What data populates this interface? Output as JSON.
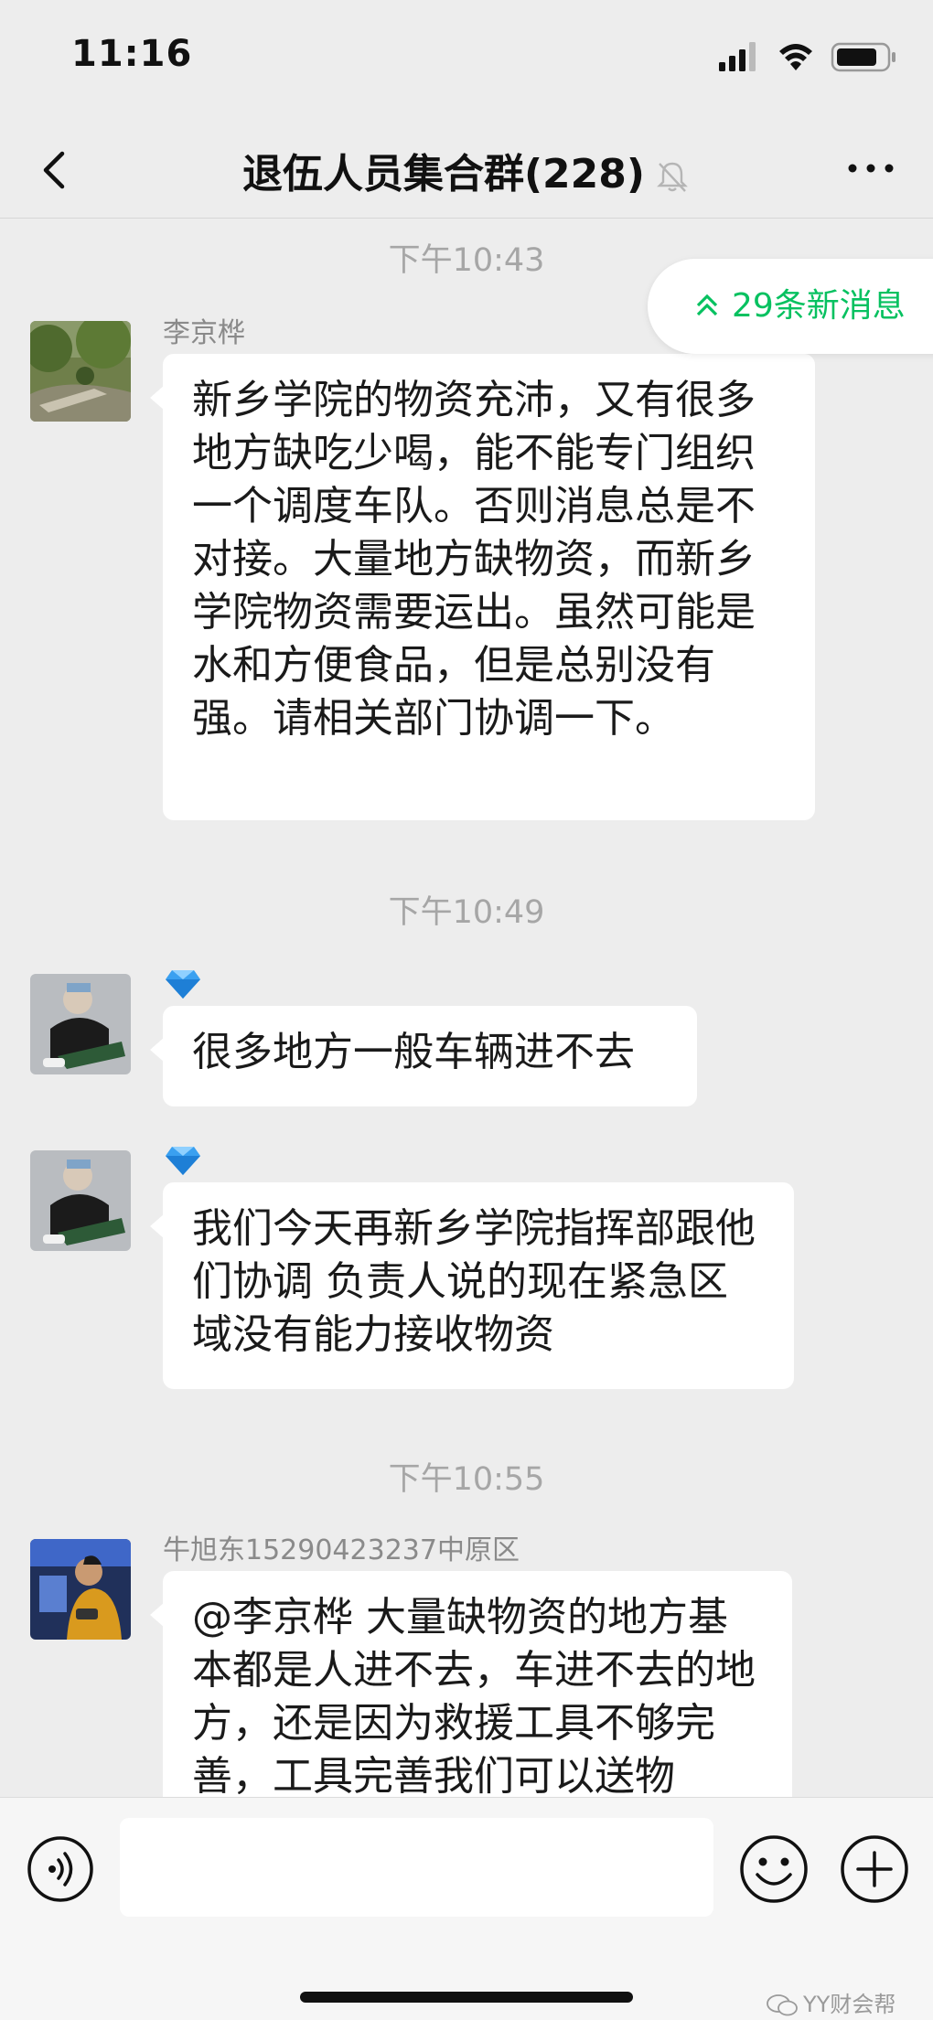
{
  "status_bar": {
    "time": "11:16"
  },
  "header": {
    "title": "退伍人员集合群(228)"
  },
  "new_messages_pill": {
    "label": "29条新消息",
    "color": "#07c160"
  },
  "timestamps": [
    "下午10:43",
    "下午10:49",
    "下午10:55"
  ],
  "messages": [
    {
      "sender": "李京桦",
      "text": "新乡学院的物资充沛，又有很多地方缺吃少喝，能不能专门组织一个调度车队。否则消息总是不对接。大量地方缺物资，而新乡学院物资需要运出。虽然可能是水和方便食品，但是总别没有强。请相关部门协调一下。"
    },
    {
      "sender_badge": "diamond-icon",
      "text": "很多地方一般车辆进不去"
    },
    {
      "sender_badge": "diamond-icon",
      "text": "我们今天再新乡学院指挥部跟他们协调 负责人说的现在紧急区域没有能力接收物资"
    },
    {
      "sender": "牛旭东15290423237中原区",
      "text": "@李京桦 大量缺物资的地方基本都是人进不去，车进不去的地方，还是因为救援工具不够完善，工具完善我们可以送物"
    }
  ],
  "input_bar": {
    "text_value": ""
  },
  "watermark": {
    "text": "YY财会帮"
  },
  "colors": {
    "background": "#ededed",
    "bubble": "#ffffff",
    "accent": "#07c160"
  }
}
